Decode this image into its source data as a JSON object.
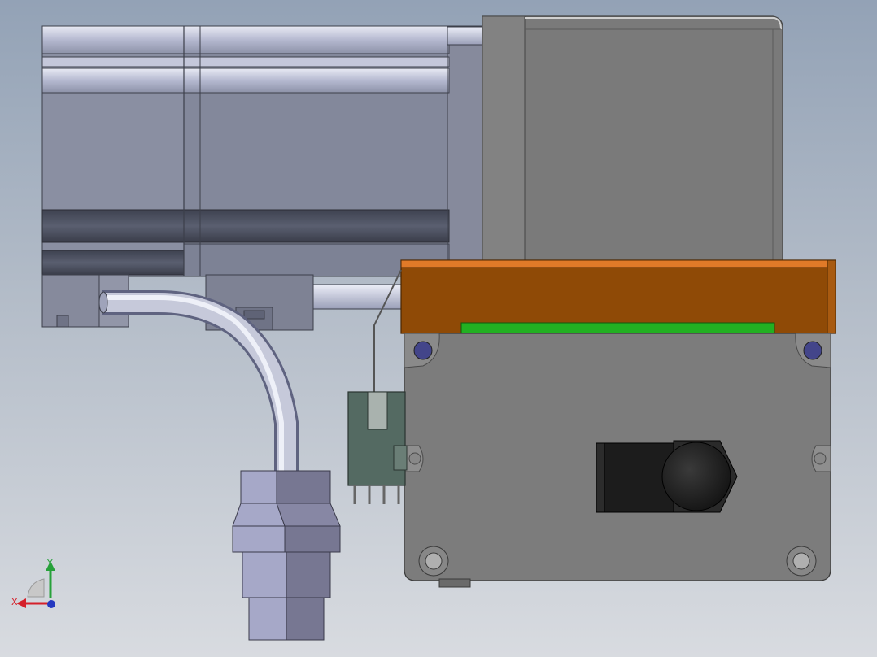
{
  "viewport": {
    "background_top": "#93a2b6",
    "background_bottom": "#d8dbe0"
  },
  "model": {
    "colors": {
      "motor_body": "#83889b",
      "motor_highlight": "#c9cde0",
      "motor_dark": "#4a4e5c",
      "gearbox": "#7a7a7a",
      "gearbox_edge": "#5e5e5e",
      "top_cover": "#8f4a06",
      "top_cover_edge": "#e07a28",
      "pcb_strip": "#22b022",
      "front_plate": "#7c7c7c",
      "screw_head": "#43458a",
      "cable": "#aeb2c8",
      "connector_light": "#a6a8c8",
      "connector_dark": "#777792",
      "terminal_block": "#546a62",
      "fitting_black": "#1c1c1c"
    }
  },
  "triad": {
    "x_label": "X",
    "y_label": "Y",
    "x_color": "#d4202a",
    "y_color": "#27a13a",
    "z_color": "#2438c0"
  }
}
